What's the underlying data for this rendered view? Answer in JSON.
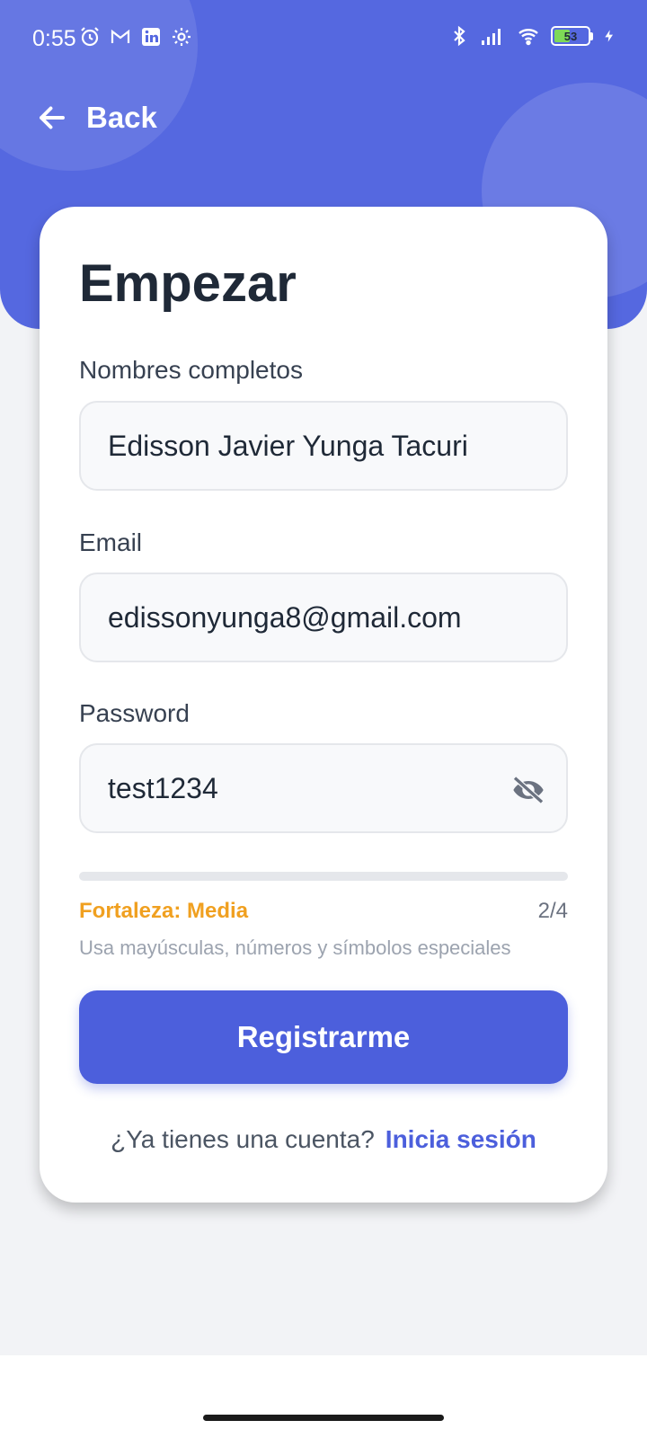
{
  "status_bar": {
    "time": "0:55",
    "battery": "53",
    "battery_level": 0.53,
    "icons_left": [
      "alarm-icon",
      "gmail-icon",
      "linkedin-icon",
      "settings-icon"
    ],
    "icons_right": [
      "bluetooth-icon",
      "signal-icon",
      "wifi-icon",
      "battery-icon",
      "charging-icon"
    ]
  },
  "nav": {
    "back_label": "Back"
  },
  "form": {
    "title": "Empezar",
    "name_label": "Nombres completos",
    "name_value": "Edisson Javier Yunga Tacuri",
    "email_label": "Email",
    "email_value": "edissonyunga8@gmail.com",
    "password_label": "Password",
    "password_value": "test1234",
    "strength_label": "Fortaleza: Media",
    "strength_score": "2/4",
    "strength_hint": "Usa mayúsculas, números y símbolos especiales",
    "submit_label": "Registrarme",
    "login_prompt": "¿Ya tienes una cuenta?",
    "login_link": "Inicia sesión"
  },
  "colors": {
    "header": "#5568e0",
    "accent": "#4c5fdc",
    "strength_medium": "#f0a020",
    "background": "#f2f3f6"
  }
}
